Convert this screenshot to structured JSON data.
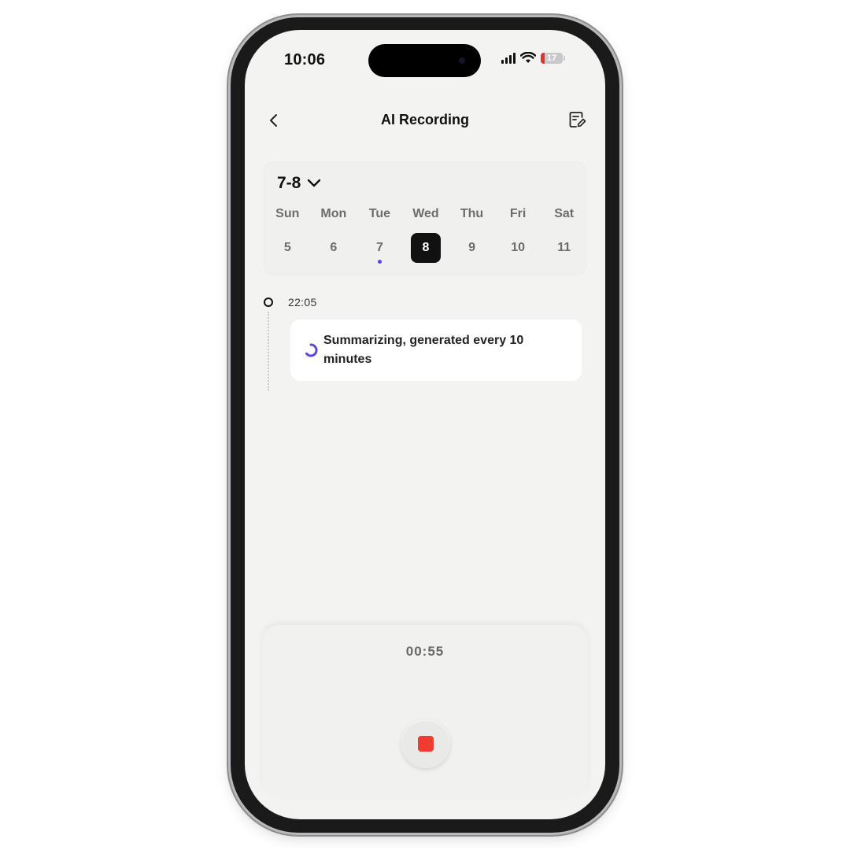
{
  "status_bar": {
    "time": "10:06",
    "battery_level": "17",
    "battery_fraction": 0.17,
    "battery_color": "#e5322e"
  },
  "header": {
    "title": "AI Recording",
    "back_icon": "chevron-left-icon",
    "edit_icon": "edit-note-icon"
  },
  "calendar": {
    "month_label": "7-8",
    "weekdays": [
      "Sun",
      "Mon",
      "Tue",
      "Wed",
      "Thu",
      "Fri",
      "Sat"
    ],
    "dates": [
      "5",
      "6",
      "7",
      "8",
      "9",
      "10",
      "11"
    ],
    "selected_date": "8",
    "marked_date": "7",
    "marker_color": "#5b48d8"
  },
  "timeline": {
    "entries": [
      {
        "time": "22:05",
        "status_text": "Summarizing, generated every 10 minutes",
        "icon": "loading-spinner-icon",
        "icon_color": "#5b48d8"
      }
    ]
  },
  "recorder": {
    "elapsed": "00:55",
    "stop_color": "#ef3b32"
  },
  "colors": {
    "background": "#f3f3f1",
    "accent": "#5b48d8",
    "selected_day_bg": "#111111"
  }
}
